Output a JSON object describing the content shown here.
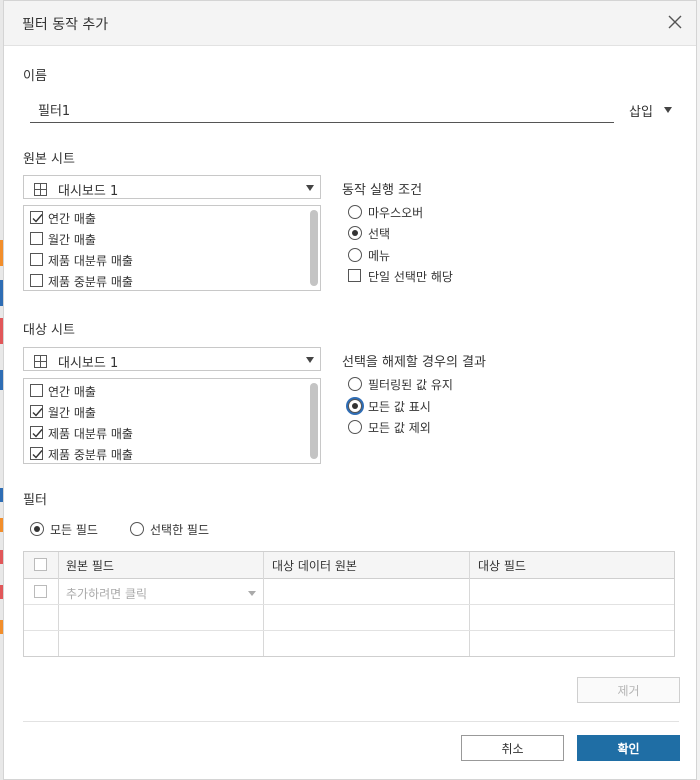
{
  "dialog": {
    "title": "필터 동작 추가"
  },
  "name_section": {
    "label": "이름",
    "value": "필터1",
    "insert_label": "삽입"
  },
  "source_sheet": {
    "label": "원본 시트",
    "selected": "대시보드 1",
    "items": [
      {
        "label": "연간 매출",
        "checked": true
      },
      {
        "label": "월간 매출",
        "checked": false
      },
      {
        "label": "제품 대분류 매출",
        "checked": false
      },
      {
        "label": "제품 중분류 매출",
        "checked": false
      }
    ]
  },
  "run_action": {
    "label": "동작 실행 조건",
    "options": [
      {
        "label": "마우스오버",
        "selected": false
      },
      {
        "label": "선택",
        "selected": true
      },
      {
        "label": "메뉴",
        "selected": false
      }
    ],
    "single_select": {
      "label": "단일 선택만 해당",
      "checked": false
    }
  },
  "target_sheet": {
    "label": "대상 시트",
    "selected": "대시보드 1",
    "items": [
      {
        "label": "연간 매출",
        "checked": false
      },
      {
        "label": "월간 매출",
        "checked": true
      },
      {
        "label": "제품 대분류 매출",
        "checked": true
      },
      {
        "label": "제품 중분류 매출",
        "checked": true
      }
    ]
  },
  "clear_selection": {
    "label": "선택을 해제할 경우의 결과",
    "options": [
      {
        "label": "필터링된 값 유지",
        "selected": false
      },
      {
        "label": "모든 값 표시",
        "selected": true
      },
      {
        "label": "모든 값 제외",
        "selected": false
      }
    ]
  },
  "filter": {
    "label": "필터",
    "options": [
      {
        "label": "모든 필드",
        "selected": true
      },
      {
        "label": "선택한 필드",
        "selected": false
      }
    ],
    "columns": [
      "원본 필드",
      "대상 데이터 원본",
      "대상 필드"
    ],
    "placeholder": "추가하려면 클릭"
  },
  "buttons": {
    "remove": "제거",
    "cancel": "취소",
    "ok": "확인"
  },
  "colors": {
    "primary": "#1f6ea5",
    "focus": "#2f6db5"
  },
  "icons": {
    "close": "close-icon",
    "sheet": "grid-icon",
    "dropdown": "chevron-down-icon"
  }
}
